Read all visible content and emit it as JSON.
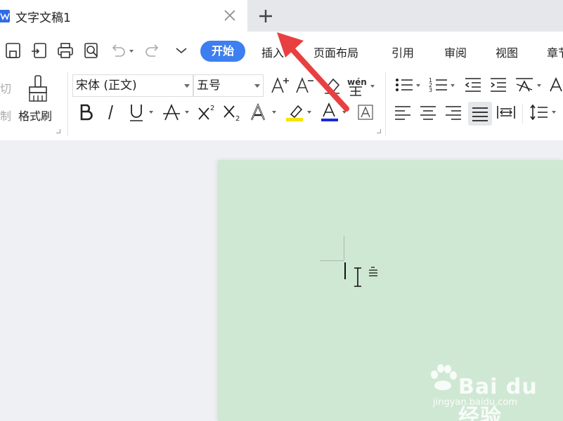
{
  "tab": {
    "title": "文字文稿1",
    "close_icon": "close-icon",
    "new_tab_icon": "plus-icon"
  },
  "quick_toolbar": {
    "icons": [
      "save-icon",
      "convert-pdf-icon",
      "print-icon",
      "print-preview-icon",
      "undo-icon",
      "redo-icon",
      "customize-dropdown-icon"
    ]
  },
  "menu": {
    "active": "开始",
    "items": [
      "插入",
      "页面布局",
      "引用",
      "审阅",
      "视图",
      "章节"
    ]
  },
  "ribbon": {
    "clipboard": {
      "cut_label": "切",
      "copy_label": "制",
      "format_painter_label": "格式刷"
    },
    "font": {
      "name": "宋体 (正文)",
      "size": "五号"
    },
    "pinyin_label": "wén"
  },
  "colors": {
    "accent": "#3d7ff0",
    "page_bg": "#cfe8d4",
    "highlight": "#f5e300",
    "font_color": "#1a2bd6",
    "arrow": "#e84040"
  },
  "watermark": {
    "brand": "Bai du 经验",
    "site": "jingyan.baidu.com"
  }
}
